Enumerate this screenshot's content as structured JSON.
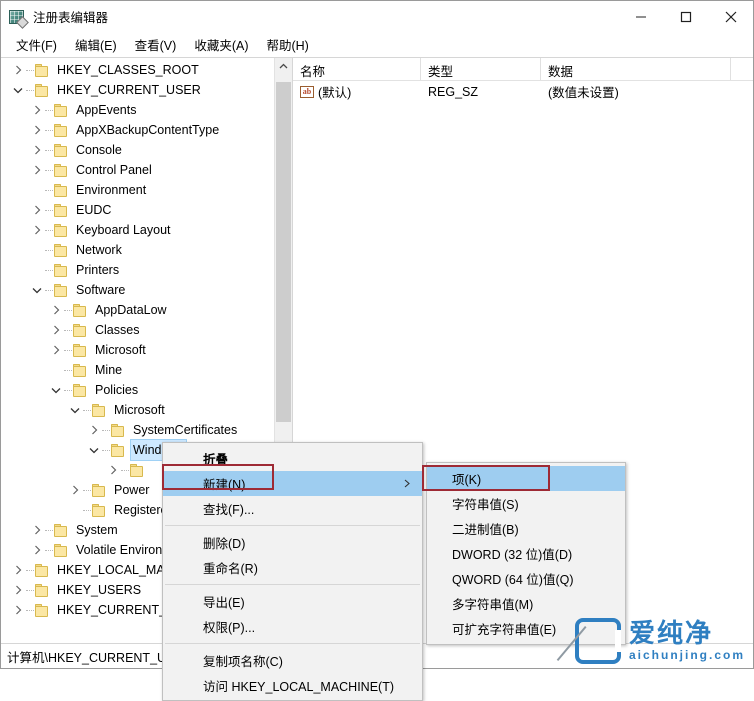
{
  "window": {
    "title": "注册表编辑器",
    "icon": "registry-editor-icon",
    "controls": {
      "minimize": "最小化",
      "maximize": "最大化",
      "close": "关闭"
    }
  },
  "menubar": {
    "items": [
      {
        "label": "文件(F)",
        "name": "menu-file"
      },
      {
        "label": "编辑(E)",
        "name": "menu-edit"
      },
      {
        "label": "查看(V)",
        "name": "menu-view"
      },
      {
        "label": "收藏夹(A)",
        "name": "menu-favorites"
      },
      {
        "label": "帮助(H)",
        "name": "menu-help"
      }
    ]
  },
  "tree": {
    "items": [
      {
        "label": "HKEY_CLASSES_ROOT",
        "depth": 0,
        "twisty": "collapsed",
        "selected": false
      },
      {
        "label": "HKEY_CURRENT_USER",
        "depth": 0,
        "twisty": "expanded",
        "selected": false
      },
      {
        "label": "AppEvents",
        "depth": 1,
        "twisty": "collapsed",
        "selected": false
      },
      {
        "label": "AppXBackupContentType",
        "depth": 1,
        "twisty": "collapsed",
        "selected": false
      },
      {
        "label": "Console",
        "depth": 1,
        "twisty": "collapsed",
        "selected": false
      },
      {
        "label": "Control Panel",
        "depth": 1,
        "twisty": "collapsed",
        "selected": false
      },
      {
        "label": "Environment",
        "depth": 1,
        "twisty": "none",
        "selected": false
      },
      {
        "label": "EUDC",
        "depth": 1,
        "twisty": "collapsed",
        "selected": false
      },
      {
        "label": "Keyboard Layout",
        "depth": 1,
        "twisty": "collapsed",
        "selected": false
      },
      {
        "label": "Network",
        "depth": 1,
        "twisty": "none",
        "selected": false
      },
      {
        "label": "Printers",
        "depth": 1,
        "twisty": "none",
        "selected": false
      },
      {
        "label": "Software",
        "depth": 1,
        "twisty": "expanded",
        "selected": false
      },
      {
        "label": "AppDataLow",
        "depth": 2,
        "twisty": "collapsed",
        "selected": false
      },
      {
        "label": "Classes",
        "depth": 2,
        "twisty": "collapsed",
        "selected": false
      },
      {
        "label": "Microsoft",
        "depth": 2,
        "twisty": "collapsed",
        "selected": false
      },
      {
        "label": "Mine",
        "depth": 2,
        "twisty": "none",
        "selected": false
      },
      {
        "label": "Policies",
        "depth": 2,
        "twisty": "expanded",
        "selected": false
      },
      {
        "label": "Microsoft",
        "depth": 3,
        "twisty": "expanded",
        "selected": false
      },
      {
        "label": "SystemCertificates",
        "depth": 4,
        "twisty": "collapsed",
        "selected": false
      },
      {
        "label": "Windows",
        "depth": 4,
        "twisty": "expanded",
        "selected": true
      },
      {
        "label": "",
        "depth": 5,
        "twisty": "collapsed",
        "selected": false
      },
      {
        "label": "Power",
        "depth": 3,
        "twisty": "collapsed",
        "selected": false
      },
      {
        "label": "Registered",
        "depth": 3,
        "twisty": "none",
        "selected": false
      },
      {
        "label": "System",
        "depth": 1,
        "twisty": "collapsed",
        "selected": false
      },
      {
        "label": "Volatile Environment",
        "depth": 1,
        "twisty": "collapsed",
        "selected": false
      },
      {
        "label": "HKEY_LOCAL_MACHINE",
        "depth": 0,
        "twisty": "collapsed",
        "selected": false
      },
      {
        "label": "HKEY_USERS",
        "depth": 0,
        "twisty": "collapsed",
        "selected": false
      },
      {
        "label": "HKEY_CURRENT_CONFIG",
        "depth": 0,
        "twisty": "collapsed",
        "selected": false
      }
    ]
  },
  "values": {
    "columns": [
      "名称",
      "类型",
      "数据"
    ],
    "rows": [
      {
        "name": "(默认)",
        "type": "REG_SZ",
        "data": "(数值未设置)",
        "icon": "string-value-icon"
      }
    ]
  },
  "statusbar": {
    "path": "计算机\\HKEY_CURRENT_USER\\Software\\Policies\\Microsoft\\Windows"
  },
  "context_menu": {
    "items": [
      {
        "label": "折叠",
        "bold": true,
        "highlight": false,
        "submenu": false,
        "name": "ctx-collapse"
      },
      {
        "label": "新建(N)",
        "bold": false,
        "highlight": true,
        "submenu": true,
        "name": "ctx-new"
      },
      {
        "label": "查找(F)...",
        "bold": false,
        "highlight": false,
        "submenu": false,
        "name": "ctx-find"
      },
      {
        "separator": true
      },
      {
        "label": "删除(D)",
        "bold": false,
        "highlight": false,
        "submenu": false,
        "name": "ctx-delete"
      },
      {
        "label": "重命名(R)",
        "bold": false,
        "highlight": false,
        "submenu": false,
        "name": "ctx-rename"
      },
      {
        "separator": true
      },
      {
        "label": "导出(E)",
        "bold": false,
        "highlight": false,
        "submenu": false,
        "name": "ctx-export"
      },
      {
        "label": "权限(P)...",
        "bold": false,
        "highlight": false,
        "submenu": false,
        "name": "ctx-permissions"
      },
      {
        "separator": true
      },
      {
        "label": "复制项名称(C)",
        "bold": false,
        "highlight": false,
        "submenu": false,
        "name": "ctx-copy-key-name"
      },
      {
        "label": "访问 HKEY_LOCAL_MACHINE(T)",
        "bold": false,
        "highlight": false,
        "submenu": false,
        "name": "ctx-goto-hklm"
      }
    ]
  },
  "submenu": {
    "items": [
      {
        "label": "项(K)",
        "highlight": true,
        "name": "submenu-key"
      },
      {
        "label": "字符串值(S)",
        "highlight": false,
        "name": "submenu-string-value"
      },
      {
        "label": "二进制值(B)",
        "highlight": false,
        "name": "submenu-binary-value"
      },
      {
        "label": "DWORD (32 位)值(D)",
        "highlight": false,
        "name": "submenu-dword-value"
      },
      {
        "label": "QWORD (64 位)值(Q)",
        "highlight": false,
        "name": "submenu-qword-value"
      },
      {
        "label": "多字符串值(M)",
        "highlight": false,
        "name": "submenu-multi-string-value"
      },
      {
        "label": "可扩充字符串值(E)",
        "highlight": false,
        "name": "submenu-expandable-string-value"
      }
    ]
  },
  "watermark": {
    "cn": "爱纯净",
    "en": "aichunjing.com",
    "color": "#2f7fc1"
  },
  "colors": {
    "highlight": "#9ecdf0",
    "selection": "#cde8ff",
    "annotation": "#9e2a35",
    "folder": "#fbe7a4"
  }
}
